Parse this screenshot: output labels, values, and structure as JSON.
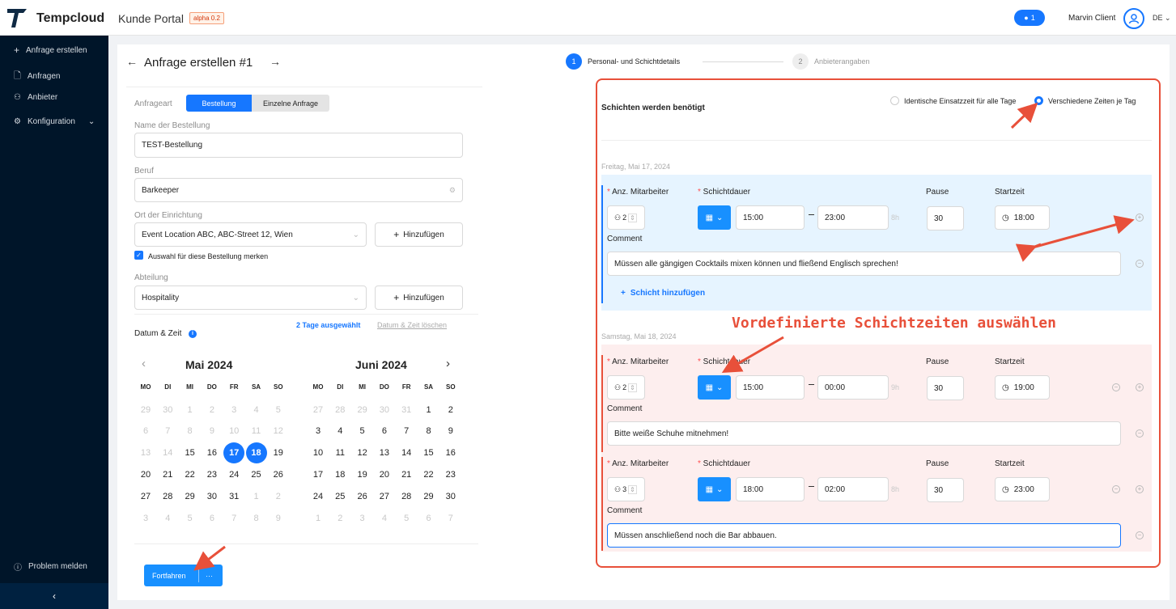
{
  "app": {
    "brand": "Tempcloud",
    "portal": "Kunde Portal",
    "version_badge": "alpha 0.2"
  },
  "topbar": {
    "notification_count": "1",
    "user_name": "Marvin Client",
    "language": "DE"
  },
  "sidebar": {
    "items": [
      {
        "label": "Anfrage erstellen",
        "icon": "plus-icon"
      },
      {
        "label": "Anfragen",
        "icon": "document-icon"
      },
      {
        "label": "Anbieter",
        "icon": "users-icon"
      },
      {
        "label": "Konfiguration",
        "icon": "gear-icon"
      }
    ],
    "report_label": "Problem melden",
    "collapse_glyph": "‹"
  },
  "page": {
    "title": "Anfrage erstellen #1"
  },
  "steps": [
    {
      "number": "1",
      "label": "Personal- und Schichtdetails",
      "active": true
    },
    {
      "number": "2",
      "label": "Anbieterangaben",
      "active": false
    }
  ],
  "form": {
    "type_label": "Anfrageart",
    "type_options": [
      "Bestellung",
      "Einzelne Anfrage"
    ],
    "type_selected": "Bestellung",
    "order_name_label": "Name der Bestellung",
    "order_name_value": "TEST-Bestellung",
    "profession_label": "Beruf",
    "profession_value": "Barkeeper",
    "location_label": "Ort der Einrichtung",
    "location_value": "Event Location ABC, ABC-Street 12, Wien",
    "add_label": "Hinzufügen",
    "remember_label": "Auswahl für diese Bestellung merken",
    "department_label": "Abteilung",
    "department_value": "Hospitality",
    "date_time_label": "Datum & Zeit",
    "days_selected": "2 Tage ausgewählt",
    "clear_dates": "Datum & Zeit löschen",
    "submit_label": "Fortfahren",
    "submit_more": "···"
  },
  "calendar": {
    "weekdays": [
      "MO",
      "DI",
      "MI",
      "DO",
      "FR",
      "SA",
      "SO"
    ],
    "months": [
      {
        "title": "Mai 2024",
        "days": [
          "29",
          "30",
          "1",
          "2",
          "3",
          "4",
          "5",
          "6",
          "7",
          "8",
          "9",
          "10",
          "11",
          "12",
          "13",
          "14",
          "15",
          "16",
          "17",
          "18",
          "19",
          "20",
          "21",
          "22",
          "23",
          "24",
          "25",
          "26",
          "27",
          "28",
          "29",
          "30",
          "31",
          "1",
          "2",
          "3",
          "4",
          "5",
          "6",
          "7",
          "8",
          "9"
        ],
        "grey": [
          0,
          1,
          2,
          3,
          4,
          5,
          6,
          7,
          8,
          9,
          10,
          11,
          12,
          13,
          14,
          15,
          33,
          34,
          35,
          36,
          37,
          38,
          39,
          40,
          41
        ],
        "selected": [
          18,
          19
        ]
      },
      {
        "title": "Juni 2024",
        "days": [
          "27",
          "28",
          "29",
          "30",
          "31",
          "1",
          "2",
          "3",
          "4",
          "5",
          "6",
          "7",
          "8",
          "9",
          "10",
          "11",
          "12",
          "13",
          "14",
          "15",
          "16",
          "17",
          "18",
          "19",
          "20",
          "21",
          "22",
          "23",
          "24",
          "25",
          "26",
          "27",
          "28",
          "29",
          "30",
          "1",
          "2",
          "3",
          "4",
          "5",
          "6",
          "7"
        ],
        "grey": [
          0,
          1,
          2,
          3,
          4,
          35,
          36,
          37,
          38,
          39,
          40,
          41
        ],
        "selected": []
      }
    ]
  },
  "shifts": {
    "section_title": "Schichten werden benötigt",
    "option_identical": "Identische Einsatzzeit für alle Tage",
    "option_different": "Verschiedene Zeiten je Tag",
    "option_selected": "Verschiedene Zeiten je Tag",
    "col_employees": "Anz. Mitarbeiter",
    "col_duration": "Schichtdauer",
    "col_break": "Pause",
    "col_start": "Startzeit",
    "comment_label": "Comment",
    "add_shift": "Schicht hinzufügen",
    "days": [
      {
        "date": "Freitag, Mai 17, 2024",
        "color": "#e6f4ff",
        "rows": [
          {
            "employees": "2",
            "from": "15:00",
            "to": "23:00",
            "hours": "8h",
            "break": "30",
            "start": "18:00",
            "comment": "Müssen alle gängigen Cocktails mixen können und fließend Englisch sprechen!"
          }
        ]
      },
      {
        "date": "Samstag, Mai 18, 2024",
        "color": "#fdeeee",
        "rows": [
          {
            "employees": "2",
            "from": "15:00",
            "to": "00:00",
            "hours": "9h",
            "break": "30",
            "start": "19:00",
            "comment": "Bitte weiße Schuhe mitnehmen!"
          },
          {
            "employees": "3",
            "from": "18:00",
            "to": "02:00",
            "hours": "8h",
            "break": "30",
            "start": "23:00",
            "comment": "Müssen anschließend noch die Bar abbauen."
          }
        ]
      }
    ]
  },
  "annotation": {
    "text": "Vordefinierte Schichtzeiten auswählen",
    "color": "#e8503a"
  },
  "colors": {
    "primary": "#1677ff",
    "sidebar": "#001529",
    "accent_red": "#e8503a"
  }
}
